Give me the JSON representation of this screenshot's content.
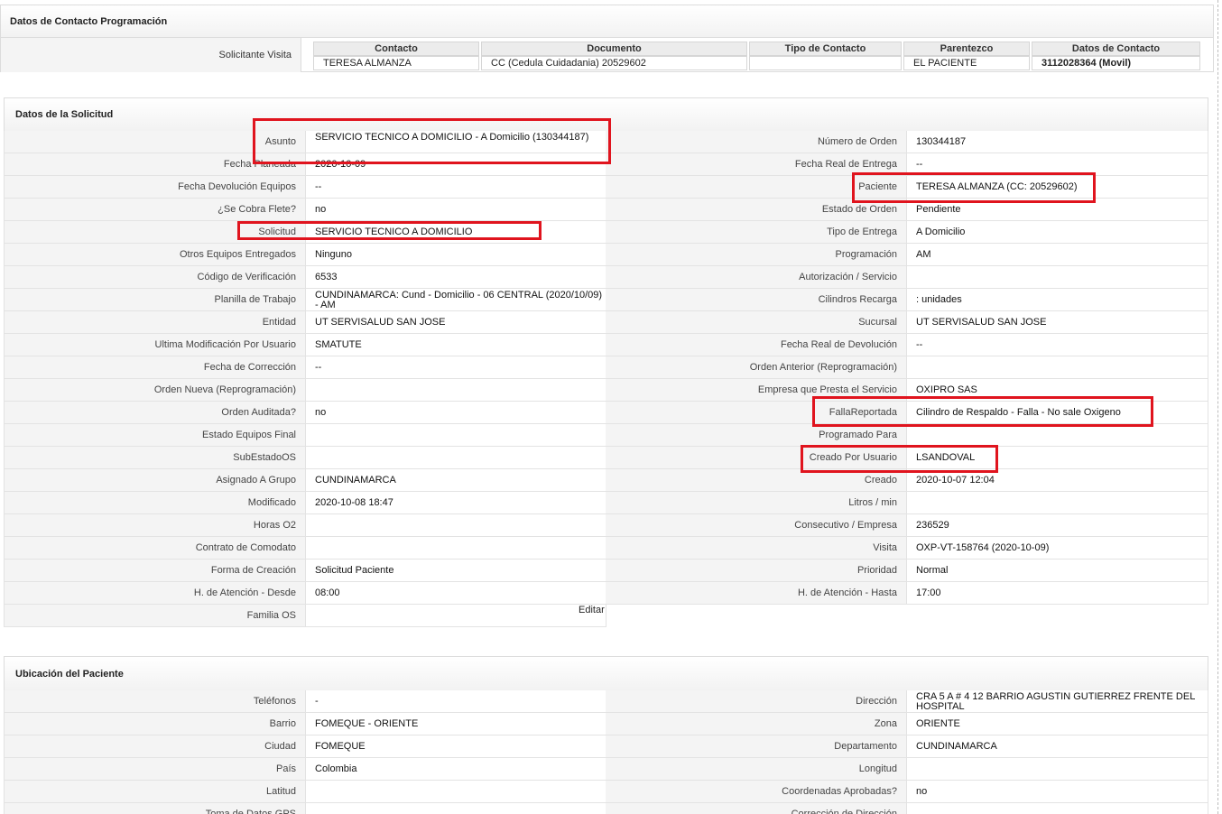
{
  "contact_section": {
    "title": "Datos de Contacto Programación",
    "row_label": "Solicitante Visita",
    "headers": [
      "Contacto",
      "Documento",
      "Tipo de Contacto",
      "Parentezco",
      "Datos de Contacto"
    ],
    "row": [
      "TERESA ALMANZA",
      "CC (Cedula Cuidadania) 20529602",
      "",
      "EL PACIENTE",
      "3112028364 (Movil)"
    ]
  },
  "solicitud_section": {
    "title": "Datos de la Solicitud",
    "left": [
      {
        "label": "Asunto",
        "value": "SERVICIO TECNICO A DOMICILIO - A Domicilio (130344187)"
      },
      {
        "label": "Fecha Planeada",
        "value": "2020-10-09"
      },
      {
        "label": "Fecha Devolución Equipos",
        "value": "--"
      },
      {
        "label": "¿Se Cobra Flete?",
        "value": "no"
      },
      {
        "label": "Solicitud",
        "value": "SERVICIO TECNICO A DOMICILIO"
      },
      {
        "label": "Otros Equipos Entregados",
        "value": "Ninguno"
      },
      {
        "label": "Código de Verificación",
        "value": "6533"
      },
      {
        "label": "Planilla de Trabajo",
        "value": "CUNDINAMARCA: Cund - Domicilio - 06 CENTRAL (2020/10/09) - AM"
      },
      {
        "label": "Entidad",
        "value": "UT SERVISALUD SAN JOSE"
      },
      {
        "label": "Ultima Modificación Por Usuario",
        "value": "SMATUTE"
      },
      {
        "label": "Fecha de Corrección",
        "value": "--"
      },
      {
        "label": "Orden Nueva (Reprogramación)",
        "value": ""
      },
      {
        "label": "Orden Auditada?",
        "value": "no"
      },
      {
        "label": "Estado Equipos Final",
        "value": ""
      },
      {
        "label": "SubEstadoOS",
        "value": ""
      },
      {
        "label": "Asignado A Grupo",
        "value": "CUNDINAMARCA"
      },
      {
        "label": "Modificado",
        "value": "2020-10-08 18:47"
      },
      {
        "label": "Horas O2",
        "value": ""
      },
      {
        "label": "Contrato de Comodato",
        "value": ""
      },
      {
        "label": "Forma de Creación",
        "value": "Solicitud Paciente"
      },
      {
        "label": "H. de Atención - Desde",
        "value": "08:00"
      },
      {
        "label": "Familia OS",
        "value": ""
      }
    ],
    "right": [
      {
        "label": "Número de Orden",
        "value": "130344187"
      },
      {
        "label": "Fecha Real de Entrega",
        "value": "--"
      },
      {
        "label": "Paciente",
        "value": "TERESA ALMANZA (CC: 20529602)"
      },
      {
        "label": "Estado de Orden",
        "value": "Pendiente"
      },
      {
        "label": "Tipo de Entrega",
        "value": "A Domicilio"
      },
      {
        "label": "Programación",
        "value": "AM"
      },
      {
        "label": "Autorización / Servicio",
        "value": ""
      },
      {
        "label": "Cilindros Recarga",
        "value": ": unidades"
      },
      {
        "label": "Sucursal",
        "value": "UT SERVISALUD SAN JOSE"
      },
      {
        "label": "Fecha Real de Devolución",
        "value": "--"
      },
      {
        "label": "Orden Anterior (Reprogramación)",
        "value": ""
      },
      {
        "label": "Empresa que Presta el Servicio",
        "value": "OXIPRO SAS"
      },
      {
        "label": "FallaReportada",
        "value": "Cilindro de Respaldo - Falla - No sale Oxigeno"
      },
      {
        "label": "Programado Para",
        "value": ""
      },
      {
        "label": "Creado Por Usuario",
        "value": "LSANDOVAL"
      },
      {
        "label": "Creado",
        "value": "2020-10-07 12:04"
      },
      {
        "label": "Litros / min",
        "value": ""
      },
      {
        "label": "Consecutivo / Empresa",
        "value": "236529"
      },
      {
        "label": "Visita",
        "value": "OXP-VT-158764 (2020-10-09)"
      },
      {
        "label": "Prioridad",
        "value": "Normal"
      },
      {
        "label": "H. de Atención - Hasta",
        "value": "17:00"
      }
    ],
    "edit_link": "Editar"
  },
  "ubicacion_section": {
    "title": "Ubicación del Paciente",
    "left": [
      {
        "label": "Teléfonos",
        "value": "-"
      },
      {
        "label": "Barrio",
        "value": "FOMEQUE - ORIENTE"
      },
      {
        "label": "Ciudad",
        "value": "FOMEQUE"
      },
      {
        "label": "País",
        "value": "Colombia"
      },
      {
        "label": "Latitud",
        "value": ""
      },
      {
        "label": "Toma de Datos GPS",
        "value": ""
      }
    ],
    "right": [
      {
        "label": "Dirección",
        "value": "CRA 5 A # 4 12 BARRIO AGUSTIN GUTIERREZ FRENTE DEL HOSPITAL"
      },
      {
        "label": "Zona",
        "value": "ORIENTE"
      },
      {
        "label": "Departamento",
        "value": "CUNDINAMARCA"
      },
      {
        "label": "Longitud",
        "value": ""
      },
      {
        "label": "Coordenadas Aprobadas?",
        "value": "no"
      },
      {
        "label": "Corrección de Dirección",
        "value": ""
      }
    ]
  },
  "highlight_color": "#e0141e"
}
